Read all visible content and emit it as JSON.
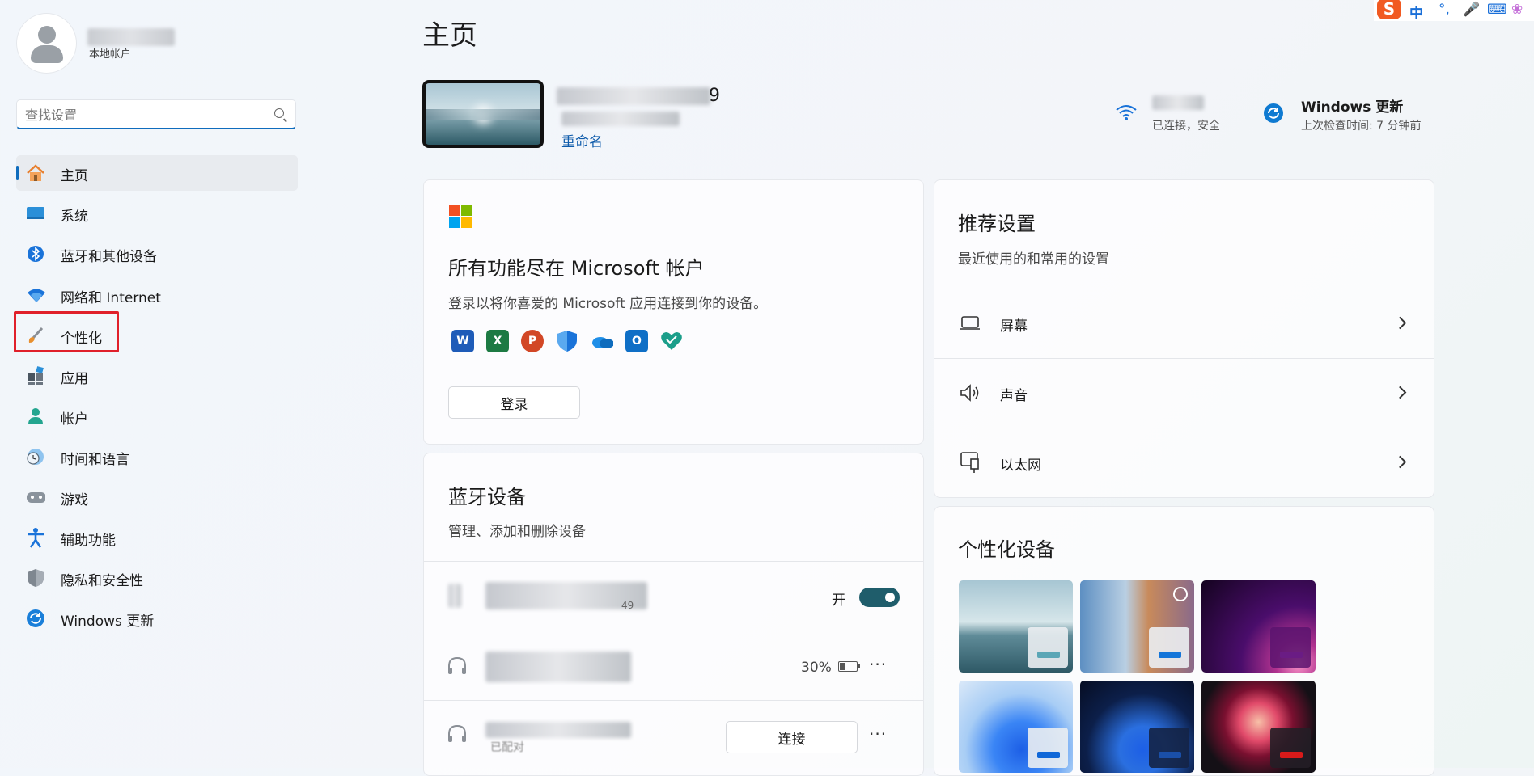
{
  "sidebar": {
    "account_type": "本地帐户",
    "search_placeholder": "查找设置",
    "items": [
      {
        "label": "主页",
        "icon": "home-icon",
        "active": true
      },
      {
        "label": "系统",
        "icon": "system-icon"
      },
      {
        "label": "蓝牙和其他设备",
        "icon": "bluetooth-icon"
      },
      {
        "label": "网络和 Internet",
        "icon": "wifi-icon"
      },
      {
        "label": "个性化",
        "icon": "brush-icon",
        "highlighted": true
      },
      {
        "label": "应用",
        "icon": "apps-icon"
      },
      {
        "label": "帐户",
        "icon": "account-icon"
      },
      {
        "label": "时间和语言",
        "icon": "clock-globe-icon"
      },
      {
        "label": "游戏",
        "icon": "gamepad-icon"
      },
      {
        "label": "辅助功能",
        "icon": "accessibility-icon"
      },
      {
        "label": "隐私和安全性",
        "icon": "shield-icon"
      },
      {
        "label": "Windows 更新",
        "icon": "windows-update-icon"
      }
    ]
  },
  "header": {
    "title": "主页",
    "device_name_suffix": "9",
    "rename_label": "重命名",
    "wifi_status": "已连接，安全",
    "update_title": "Windows 更新",
    "update_sub": "上次检查时间: 7 分钟前"
  },
  "ms_card": {
    "title": "所有功能尽在 Microsoft 帐户",
    "sub": "登录以将你喜爱的 Microsoft 应用连接到你的设备。",
    "apps": [
      {
        "icon": "word-icon",
        "letter": "W",
        "color": "#1e5bb8"
      },
      {
        "icon": "excel-icon",
        "letter": "X",
        "color": "#1d7a43"
      },
      {
        "icon": "powerpoint-icon",
        "letter": "P",
        "color": "#d24726"
      },
      {
        "icon": "defender-icon",
        "letter": "",
        "color": "#1a73d9"
      },
      {
        "icon": "onedrive-icon",
        "letter": "",
        "color": "#1f8fe8"
      },
      {
        "icon": "outlook-icon",
        "letter": "O",
        "color": "#0f6fc6"
      },
      {
        "icon": "family-icon",
        "letter": "",
        "color": "#1b9e8a"
      }
    ],
    "signin_label": "登录"
  },
  "bt_card": {
    "title": "蓝牙设备",
    "sub": "管理、添加和删除设备",
    "toggle_label": "开",
    "device_1_suffix": "49",
    "device_2_battery": "30%",
    "device_3_status": "已配对",
    "connect_label": "连接",
    "more": "···"
  },
  "recommended": {
    "title": "推荐设置",
    "sub": "最近使用的和常用的设置",
    "items": [
      {
        "label": "屏幕",
        "icon": "display-icon"
      },
      {
        "label": "声音",
        "icon": "speaker-icon"
      },
      {
        "label": "以太网",
        "icon": "ethernet-icon"
      }
    ]
  },
  "personalize": {
    "title": "个性化设备",
    "themes": [
      {
        "name": "theme-lake",
        "accent": "#5aa6b6"
      },
      {
        "name": "theme-spotlight",
        "accent": "#1475d9"
      },
      {
        "name": "theme-glow",
        "accent": "#6a1c84"
      },
      {
        "name": "theme-bloom-light",
        "accent": "#0f67d8"
      },
      {
        "name": "theme-bloom-dark",
        "accent": "#1a4fa8"
      },
      {
        "name": "theme-flow",
        "accent": "#d81a1a"
      }
    ]
  },
  "ime": {
    "lang": "中",
    "punct": "°,"
  }
}
